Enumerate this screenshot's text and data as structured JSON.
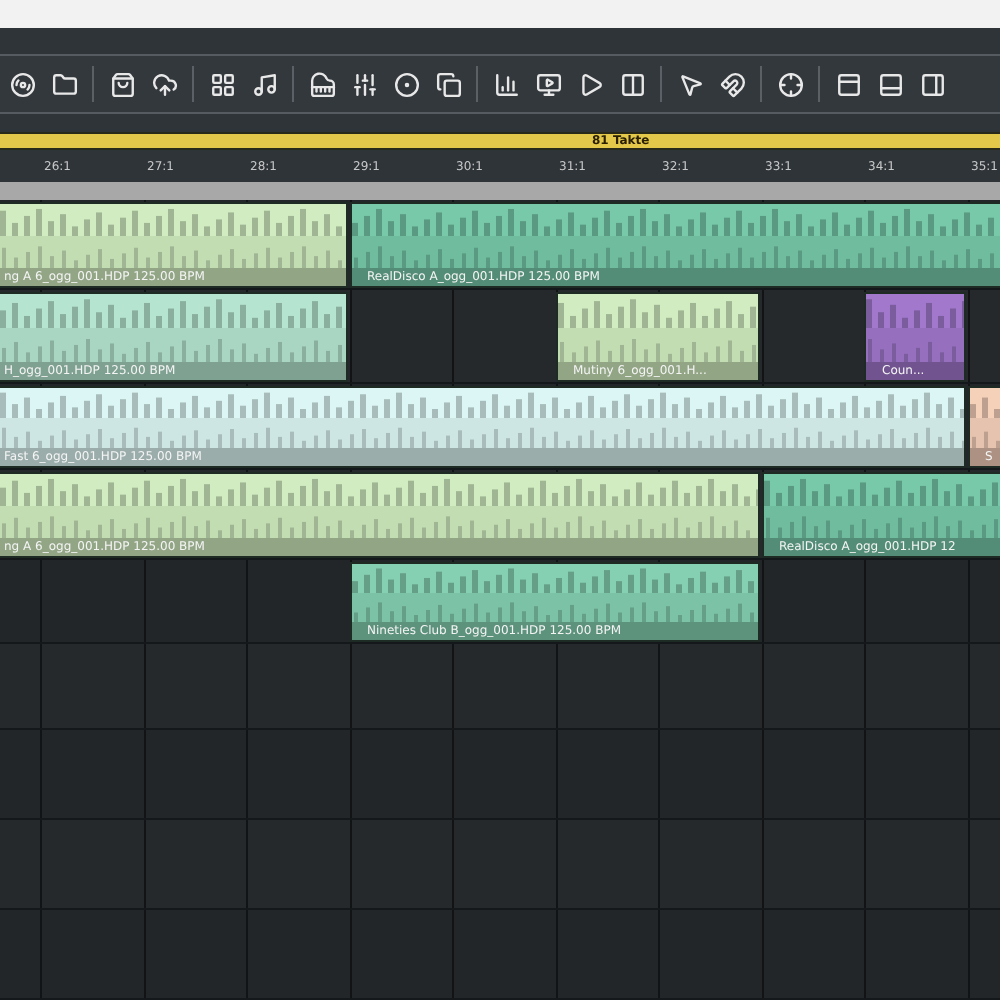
{
  "range_bar": {
    "label": "81 Takte"
  },
  "ruler": {
    "labels": [
      "26:1",
      "27:1",
      "28:1",
      "29:1",
      "30:1",
      "31:1",
      "32:1",
      "33:1",
      "34:1",
      "35:1"
    ]
  },
  "tracks": [
    {
      "clips": [
        {
          "name": "ng A 6_ogg_001.HDP  125.00 BPM",
          "color": "#c3ddb3"
        },
        {
          "name": "RealDisco A_ogg_001.HDP  125.00 BPM",
          "color": "#6fbc9e"
        }
      ]
    },
    {
      "clips": [
        {
          "name": "H_ogg_001.HDP  125.00 BPM",
          "color": "#a9d6c2"
        },
        {
          "name": "Mutiny 6_ogg_001.H...",
          "color": "#c3ddb3"
        },
        {
          "name": "Coun...",
          "color": "#9670bf"
        }
      ]
    },
    {
      "clips": [
        {
          "name": "Fast 6_ogg_001.HDP  125.00 BPM",
          "color": "#cde6e4"
        },
        {
          "name": "S",
          "color": "#e6c3ae"
        }
      ]
    },
    {
      "clips": [
        {
          "name": "ng A 6_ogg_001.HDP  125.00 BPM",
          "color": "#c3ddb3"
        },
        {
          "name": "RealDisco A_ogg_001.HDP  12",
          "color": "#6fbc9e"
        }
      ]
    },
    {
      "clips": [
        {
          "name": "Nineties Club B_ogg_001.HDP  125.00 BPM",
          "color": "#7cc2a6"
        }
      ]
    }
  ]
}
